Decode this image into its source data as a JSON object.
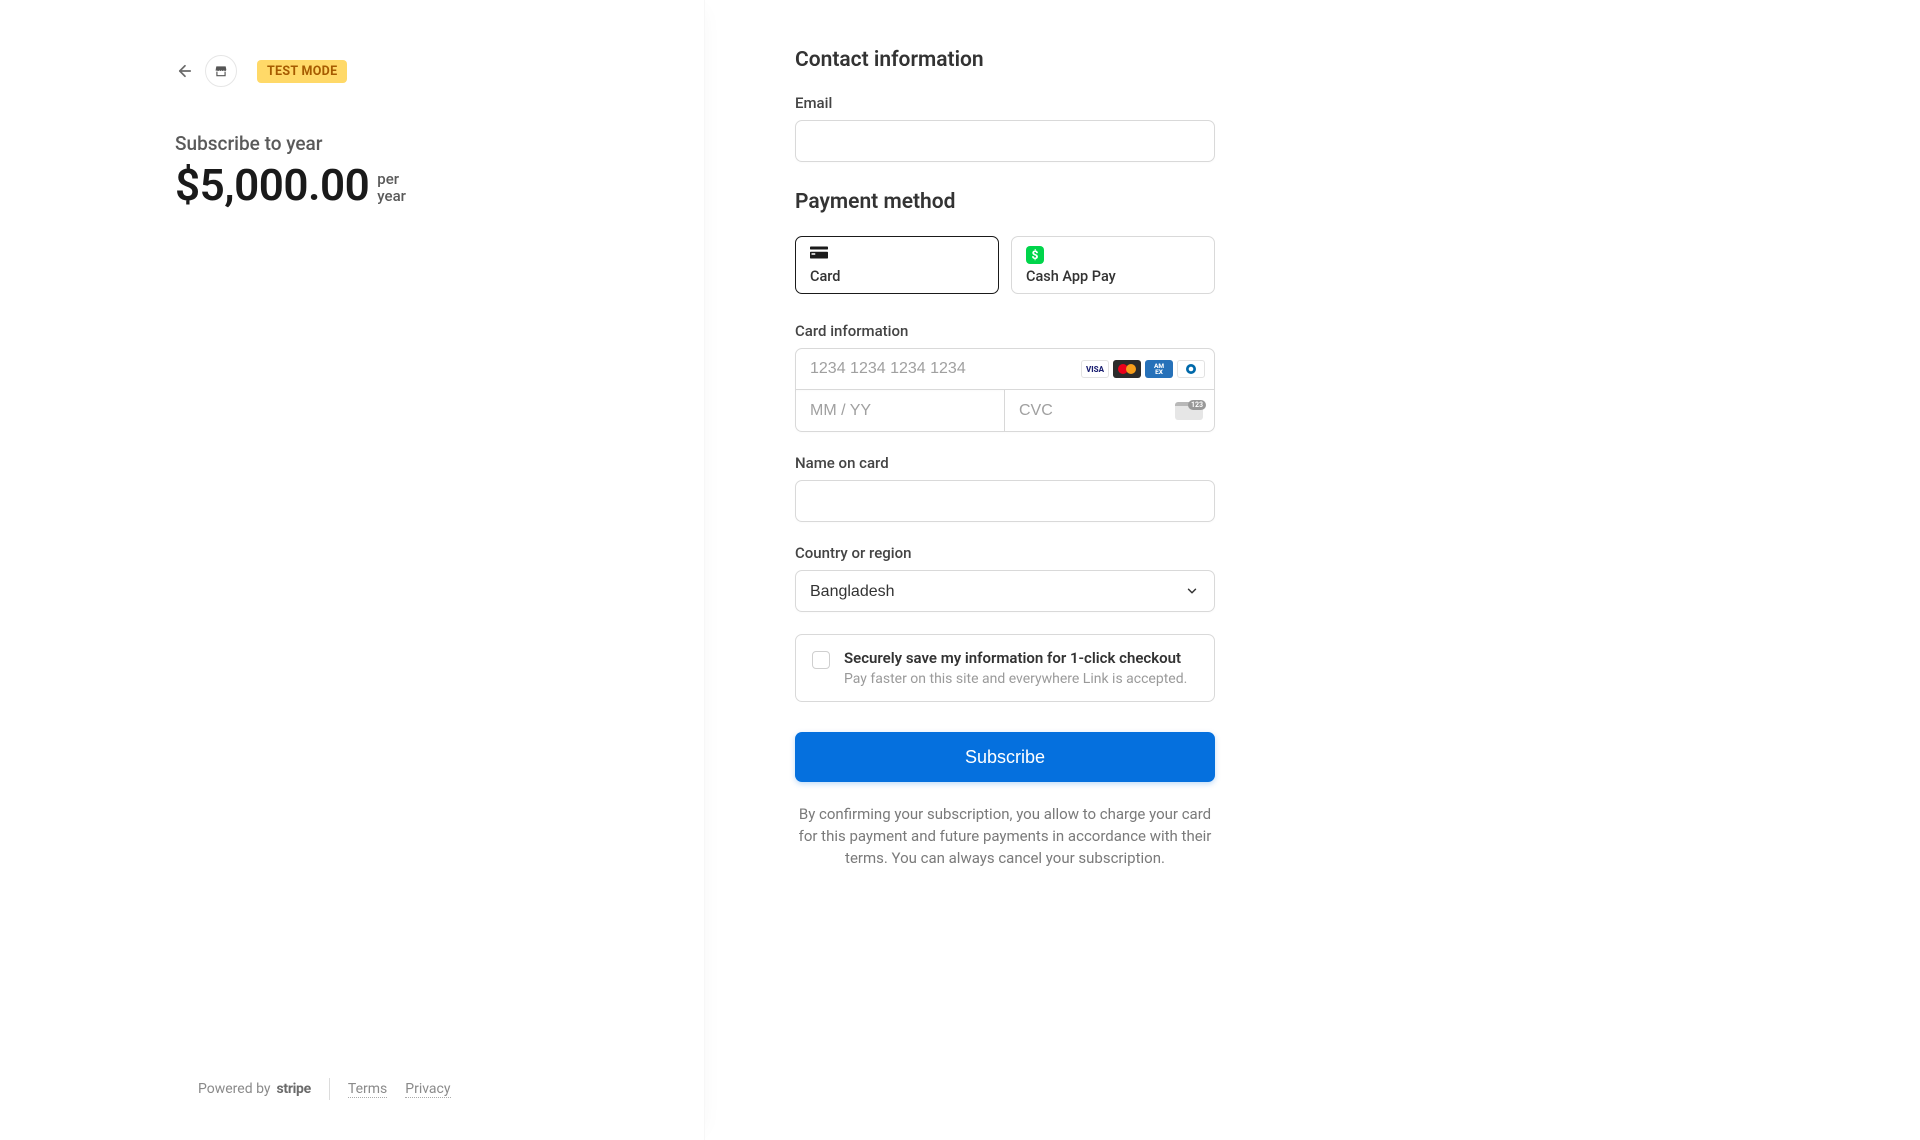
{
  "left": {
    "test_mode_label": "TEST MODE",
    "subscribe_title": "Subscribe to year",
    "price": "$5,000.00",
    "freq_line1": "per",
    "freq_line2": "year"
  },
  "footer": {
    "powered_by": "Powered by",
    "brand": "stripe",
    "terms": "Terms",
    "privacy": "Privacy"
  },
  "contact": {
    "heading": "Contact information",
    "email_label": "Email",
    "email_value": ""
  },
  "payment": {
    "heading": "Payment method",
    "methods": [
      {
        "id": "card",
        "label": "Card",
        "selected": true
      },
      {
        "id": "cashapp",
        "label": "Cash App Pay",
        "selected": false
      }
    ],
    "card_info_label": "Card information",
    "card_number_placeholder": "1234 1234 1234 1234",
    "expiry_placeholder": "MM / YY",
    "cvc_placeholder": "CVC",
    "brands": {
      "visa": "VISA",
      "amex": "AM\nEX"
    },
    "name_label": "Name on card",
    "name_value": "",
    "country_label": "Country or region",
    "country_value": "Bangladesh"
  },
  "link": {
    "title": "Securely save my information for 1-click checkout",
    "subtitle": "Pay faster on this site and everywhere Link is accepted.",
    "checked": false
  },
  "submit": {
    "label": "Subscribe"
  },
  "disclaimer": "By confirming your subscription, you allow to charge your card for this payment and future payments in accordance with their terms. You can always cancel your subscription."
}
